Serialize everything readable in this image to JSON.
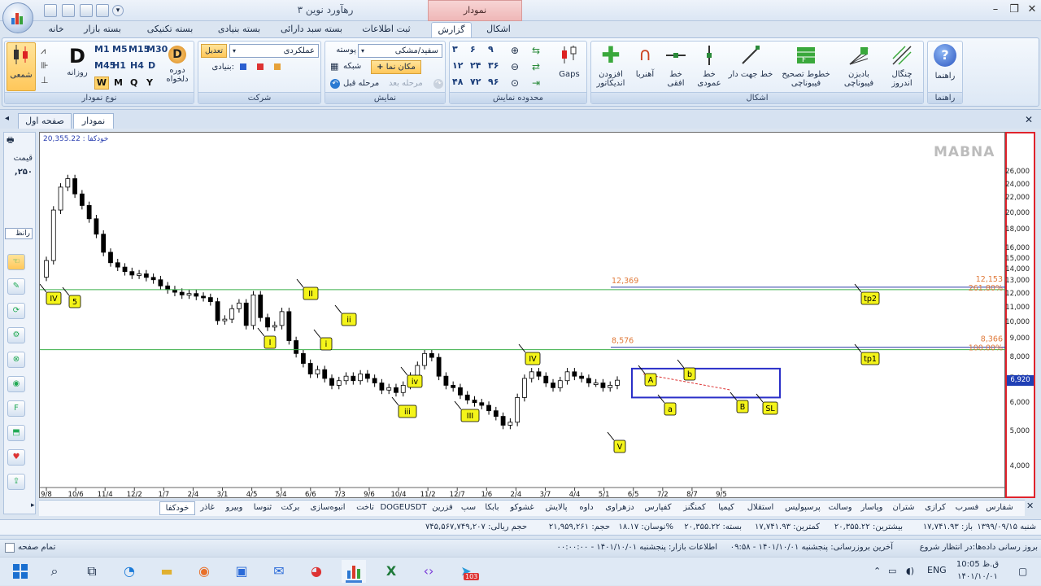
{
  "window": {
    "title": "رهآورد نوین ۳",
    "context_tab": "نمودار"
  },
  "ribbon_tabs": [
    {
      "label": "خانه"
    },
    {
      "label": "بسته بازار"
    },
    {
      "label": "بسته تکنیکی"
    },
    {
      "label": "بسته بنیادی"
    },
    {
      "label": "بسته سبد دارائی"
    },
    {
      "label": "ثبت اطلاعات"
    },
    {
      "label": "گزارش"
    },
    {
      "label": "اشکال"
    }
  ],
  "groups": {
    "chart_type": {
      "label": "نوع نمودار",
      "candle": "شمعی",
      "daily": "روزانه",
      "period": "دوره دلخواه",
      "timeframes": [
        "M1",
        "M5",
        "M15",
        "M30",
        "M45",
        "H1",
        "H4",
        "D"
      ],
      "periods": [
        "W",
        "M",
        "Q",
        "Y"
      ]
    },
    "company": {
      "label": "شرکت",
      "company_select": "عملکردی",
      "adjust": "تعدیل",
      "fundamental": "بنیادی:"
    },
    "display": {
      "label": "نمایش",
      "theme_label": "پوسته",
      "theme_value": "سفید/مشکی",
      "cursor": "مکان نما",
      "grid": "شبکه",
      "prev": "مرحله قبل",
      "next": "مرحله بعد"
    },
    "range": {
      "label": "محدوده نمایش",
      "codes": [
        "۳",
        "۶",
        "۹",
        "۱۲",
        "۲۴",
        "۳۶",
        "۴۸",
        "۷۲",
        "۹۶"
      ],
      "gaps": "Gaps"
    },
    "shapes": {
      "label": "اشکال",
      "items": [
        "افزودن اندیکاتور",
        "آهنربا",
        "خط افقی",
        "خط عمودی",
        "خط جهت دار",
        "خطوط تصحیح فیبوناچی",
        "بادبزن فیبوناچی",
        "چنگال اندروز"
      ]
    },
    "help": {
      "label": "راهنما",
      "item": "راهنما"
    }
  },
  "doc_tabs": [
    {
      "label": "نمودار"
    },
    {
      "label": "صفحه اول"
    }
  ],
  "left_panel": {
    "price_label": "قیمت",
    "price_value": ",۲۵۰",
    "search": "رانظ"
  },
  "chart_data": {
    "type": "candlestick",
    "symbol_header": "خودکفا : 20,355.22",
    "watermark": "MABNA",
    "y_scale": "log",
    "ylim": [
      3500,
      32000
    ],
    "y_ticks": [
      "26,000",
      "24,000",
      "22,000",
      "20,000",
      "18,000",
      "16,000",
      "15,000",
      "14,000",
      "13,000",
      "12,000",
      "11,000",
      "10,000",
      "9,000",
      "8,000",
      "7,000",
      "6,000",
      "5,000",
      "4,000"
    ],
    "last_price": "6,920",
    "x_ticks": [
      "9/8",
      "10/6",
      "11/4",
      "12/2",
      "1/7",
      "2/4",
      "3/1",
      "4/5",
      "5/4",
      "6/6",
      "7/3",
      "9/6",
      "10/4",
      "11/2",
      "12/7",
      "1/6",
      "2/4",
      "3/7",
      "4/4",
      "5/1",
      "6/5",
      "7/2",
      "8/7",
      "9/5"
    ],
    "closes": [
      14800,
      20400,
      23600,
      24900,
      22600,
      21000,
      19300,
      17500,
      15600,
      14600,
      14200,
      13800,
      13500,
      13600,
      13300,
      13100,
      12600,
      12300,
      12100,
      11900,
      12000,
      11800,
      11700,
      11400,
      10100,
      10200,
      10900,
      11300,
      9800,
      11900,
      10300,
      9700,
      9800,
      10700,
      8900,
      8200,
      7700,
      7200,
      7400,
      7000,
      6700,
      6900,
      7100,
      6900,
      7200,
      7000,
      6800,
      6500,
      6600,
      6400,
      6700,
      7100,
      7600,
      8200,
      8000,
      7100,
      6700,
      6600,
      6300,
      6100,
      6000,
      5900,
      5700,
      5500,
      5200,
      5300,
      6200,
      7000,
      7300,
      7100,
      6800,
      6600,
      6900,
      7300,
      7100,
      7000,
      6800,
      6800,
      6600,
      6700,
      6920
    ],
    "levels": [
      {
        "label": "12,369",
        "pct": "261.80%",
        "right_label": "12,153",
        "value": 12300
      },
      {
        "label": "8,576",
        "pct": "100.00%",
        "right_label": "8,366",
        "value": 8400
      }
    ],
    "wave_labels": [
      {
        "text": "5"
      },
      {
        "text": "IV"
      },
      {
        "text": "I"
      },
      {
        "text": "II"
      },
      {
        "text": "i"
      },
      {
        "text": "ii"
      },
      {
        "text": "iii"
      },
      {
        "text": "iv"
      },
      {
        "text": "III"
      },
      {
        "text": "IV"
      },
      {
        "text": "V"
      },
      {
        "text": "A"
      },
      {
        "text": "a"
      },
      {
        "text": "b"
      },
      {
        "text": "B"
      },
      {
        "text": "SL"
      },
      {
        "text": "tp2"
      },
      {
        "text": "tp1"
      }
    ]
  },
  "symbol_tabs": [
    {
      "label": "شفارس"
    },
    {
      "label": "فسرب"
    },
    {
      "label": "کرازی"
    },
    {
      "label": "شتران"
    },
    {
      "label": "وپاسار"
    },
    {
      "label": "وسالت"
    },
    {
      "label": "پرسپولیس"
    },
    {
      "label": "استقلال"
    },
    {
      "label": "کیمیا"
    },
    {
      "label": "کمنگنز"
    },
    {
      "label": "کفپارس"
    },
    {
      "label": "دزهراوی"
    },
    {
      "label": "داوه"
    },
    {
      "label": "پالایش"
    },
    {
      "label": "غشوکو"
    },
    {
      "label": "بابکا"
    },
    {
      "label": "سپ"
    },
    {
      "label": "فزرین"
    },
    {
      "label": "DOGEUSDT"
    },
    {
      "label": "تاخت"
    },
    {
      "label": "انبوه‌سازی"
    },
    {
      "label": "برکت"
    },
    {
      "label": "ثنوسا"
    },
    {
      "label": "وبیرو"
    },
    {
      "label": "غاذر"
    },
    {
      "label": "خودکفا"
    }
  ],
  "info_bar": [
    "شنبه ۱۳۹۹/۰۹/۱۵",
    "باز: ۱۷,۷۴۱.۹۳",
    "بیشترین: ۲۰,۳۵۵.۲۲",
    "کمترین: ۱۷,۷۴۱.۹۳",
    "بسته: ۲۰,۳۵۵.۲۲",
    "نوسان: ۱۸.۱۷%",
    "حجم: ۲۱,۹۵۹,۲۶۱",
    "حجم ریالی: ۷۴۵,۵۶۷,۷۴۹,۲۰۷"
  ],
  "status": {
    "left": "تمام صفحه",
    "right": "بروز رسانی داده‌ها:در انتظار شروع",
    "last_update": "آخرین بروزرسانی: پنجشنبه ۱۴۰۱/۱۰/۰۱ - ۰۹:۵۸",
    "market_info": "اطلاعات بازار: پنجشنبه ۱۴۰۱/۱۰/۰۱ - ۰۰:۰۰:۰۰"
  },
  "taskbar": {
    "time": "10:05 ق.ظ",
    "date": "۱۴۰۱/۱۰/۰۱",
    "lang": "ENG",
    "badge": "103"
  },
  "colors": {
    "up": "#ffffff",
    "down": "#000000",
    "level_green": "#3cb04a",
    "level_blue": "#2b3fa8",
    "fib_text": "#e07a3a",
    "box": "#2a2fc8",
    "label_bg": "#f4f41a",
    "axis_border": "#e0232c"
  }
}
